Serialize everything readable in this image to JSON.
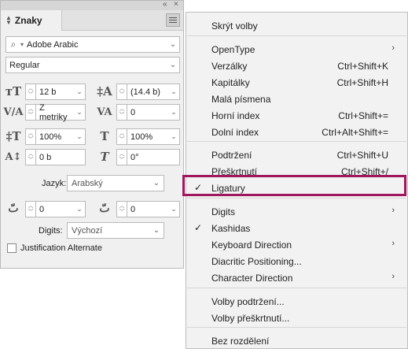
{
  "panel": {
    "title": "Znaky",
    "font_family": "Adobe Arabic",
    "font_style": "Regular",
    "font_size": "12 b",
    "leading": "(14.4 b)",
    "kerning": "Z metriky",
    "tracking": "0",
    "vertical_scale": "100%",
    "horizontal_scale": "100%",
    "baseline_shift": "0 b",
    "skew": "0°",
    "language_label": "Jazyk:",
    "language": "Arabský",
    "diacritic_x": "0",
    "diacritic_y": "0",
    "digits_label": "Digits:",
    "digits": "Výchozí",
    "justification_alternate": "Justification Alternate"
  },
  "menu": {
    "items": [
      {
        "label": "Skrýt volby",
        "shortcut": "",
        "checked": false,
        "submenu": false
      },
      {
        "label": "OpenType",
        "shortcut": "",
        "checked": false,
        "submenu": true
      },
      {
        "label": "Verzálky",
        "shortcut": "Ctrl+Shift+K",
        "checked": false,
        "submenu": false
      },
      {
        "label": "Kapitálky",
        "shortcut": "Ctrl+Shift+H",
        "checked": false,
        "submenu": false
      },
      {
        "label": "Malá písmena",
        "shortcut": "",
        "checked": false,
        "submenu": false
      },
      {
        "label": "Horní index",
        "shortcut": "Ctrl+Shift+=",
        "checked": false,
        "submenu": false
      },
      {
        "label": "Dolní index",
        "shortcut": "Ctrl+Alt+Shift+=",
        "checked": false,
        "submenu": false
      },
      {
        "label": "Podtržení",
        "shortcut": "Ctrl+Shift+U",
        "checked": false,
        "submenu": false
      },
      {
        "label": "Přeškrtnutí",
        "shortcut": "Ctrl+Shift+/",
        "checked": false,
        "submenu": false
      },
      {
        "label": "Ligatury",
        "shortcut": "",
        "checked": true,
        "submenu": false
      },
      {
        "label": "Digits",
        "shortcut": "",
        "checked": false,
        "submenu": true
      },
      {
        "label": "Kashidas",
        "shortcut": "",
        "checked": true,
        "submenu": false
      },
      {
        "label": "Keyboard Direction",
        "shortcut": "",
        "checked": false,
        "submenu": true
      },
      {
        "label": "Diacritic Positioning...",
        "shortcut": "",
        "checked": false,
        "submenu": false
      },
      {
        "label": "Character Direction",
        "shortcut": "",
        "checked": false,
        "submenu": true
      },
      {
        "label": "Volby podtržení...",
        "shortcut": "",
        "checked": false,
        "submenu": false
      },
      {
        "label": "Volby přeškrtnutí...",
        "shortcut": "",
        "checked": false,
        "submenu": false
      },
      {
        "label": "Bez rozdělení",
        "shortcut": "",
        "checked": false,
        "submenu": false
      }
    ]
  },
  "colors": {
    "highlight_border": "#a0175e",
    "panel_bg": "#f0f0f0",
    "menu_bg": "#f2f2f2"
  }
}
